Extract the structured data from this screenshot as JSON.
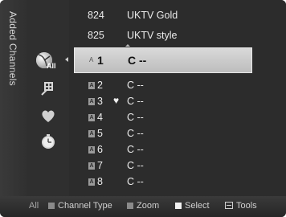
{
  "title": "Added Channels",
  "categories": [
    {
      "name": "all",
      "label": "All",
      "icon": "satellite-dish-icon"
    },
    {
      "name": "added",
      "icon": "added-channel-icon"
    },
    {
      "name": "favorites",
      "icon": "heart-icon"
    },
    {
      "name": "timer",
      "icon": "clock-icon"
    }
  ],
  "channels": [
    {
      "num": "824",
      "name": "UKTV Gold"
    },
    {
      "num": "825",
      "name": "UKTV style"
    },
    {
      "prefix": "A",
      "num": "1",
      "name": "C --",
      "selected": true
    },
    {
      "prefix": "A",
      "num": "2",
      "name": "C --"
    },
    {
      "prefix": "A",
      "num": "3",
      "fav": "♥",
      "name": "C --"
    },
    {
      "prefix": "A",
      "num": "4",
      "name": "C --"
    },
    {
      "prefix": "A",
      "num": "5",
      "name": "C --"
    },
    {
      "prefix": "A",
      "num": "6",
      "name": "C --"
    },
    {
      "prefix": "A",
      "num": "7",
      "name": "C --"
    },
    {
      "prefix": "A",
      "num": "8",
      "name": "C --"
    }
  ],
  "bottom_bar": {
    "all": "All",
    "channel_type": "Channel Type",
    "zoom": "Zoom",
    "select": "Select",
    "tools": "Tools"
  },
  "colors": {
    "background": "#2c2c2c",
    "selection": "#d0d0d0",
    "text": "#ececec"
  }
}
